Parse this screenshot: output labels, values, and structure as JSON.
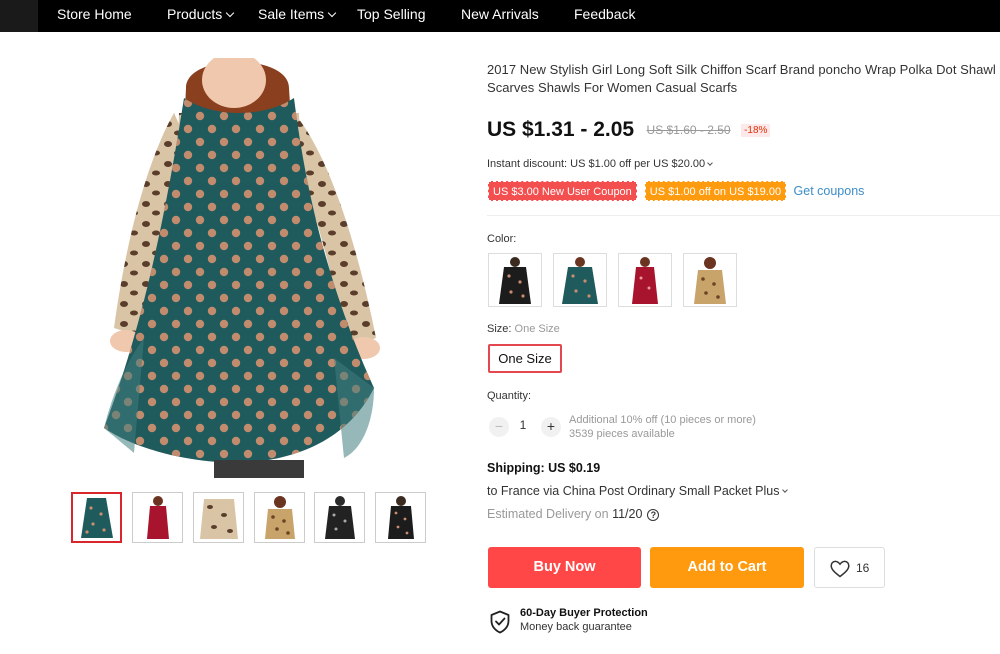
{
  "nav": {
    "items": [
      {
        "label": "Store Home",
        "dropdown": false
      },
      {
        "label": "Products",
        "dropdown": true
      },
      {
        "label": "Sale Items",
        "dropdown": true
      },
      {
        "label": "Top Selling",
        "dropdown": false
      },
      {
        "label": "New Arrivals",
        "dropdown": false
      },
      {
        "label": "Feedback",
        "dropdown": false
      }
    ]
  },
  "gallery": {
    "selected_thumbnail": 1,
    "thumbnails": [
      "teal polka dot scarf",
      "red scarf",
      "leopard scarf",
      "beige polka dot scarf",
      "black polka dot scarf",
      "black dot scarf"
    ]
  },
  "product": {
    "title": "2017 New Stylish Girl Long Soft Silk Chiffon Scarf Brand poncho Wrap Polka Dot Shawl Scarves Shawls For Women Casual Scarfs",
    "price": "US $1.31 - 2.05",
    "original_price": "US $1.60 - 2.50",
    "discount": "-18%",
    "instant_discount": "Instant discount: US $1.00 off per US $20.00",
    "coupons": {
      "new_user": "US $3.00 New User Coupon",
      "store": "US $1.00 off on US $19.00",
      "get_label": "Get coupons"
    },
    "color": {
      "label": "Color:",
      "options": [
        "black",
        "teal",
        "red",
        "beige"
      ]
    },
    "size": {
      "label": "Size:",
      "selected": "One Size",
      "option": "One Size"
    },
    "quantity": {
      "label": "Quantity:",
      "minus": "−",
      "plus": "+",
      "value": "1",
      "note_discount": "Additional 10% off (10 pieces or more)",
      "note_available": "3539 pieces available"
    },
    "shipping": {
      "title": "Shipping: US $0.19",
      "route": "to France via China Post Ordinary Small Packet Plus",
      "delivery_label": "Estimated Delivery on",
      "delivery_date": "11/20",
      "help": "?"
    },
    "actions": {
      "buy_now": "Buy Now",
      "add_to_cart": "Add to Cart",
      "wishlist_count": "16"
    },
    "protection": {
      "title": "60-Day Buyer Protection",
      "subtitle": "Money back guarantee"
    }
  },
  "colors": {
    "nav_bg": "#000000",
    "price_text": "#111111",
    "discount_red": "#e62e04",
    "coupon_red": "#f44f4f",
    "coupon_orange": "#ff9b0e",
    "link_blue": "#3c8dc8",
    "buy_now": "#ff4747",
    "add_to_cart": "#ff9a0e",
    "selected_border": "#d9262c",
    "scarf_teal": "#1f5a5c",
    "dot_peach": "#c98e6f"
  }
}
